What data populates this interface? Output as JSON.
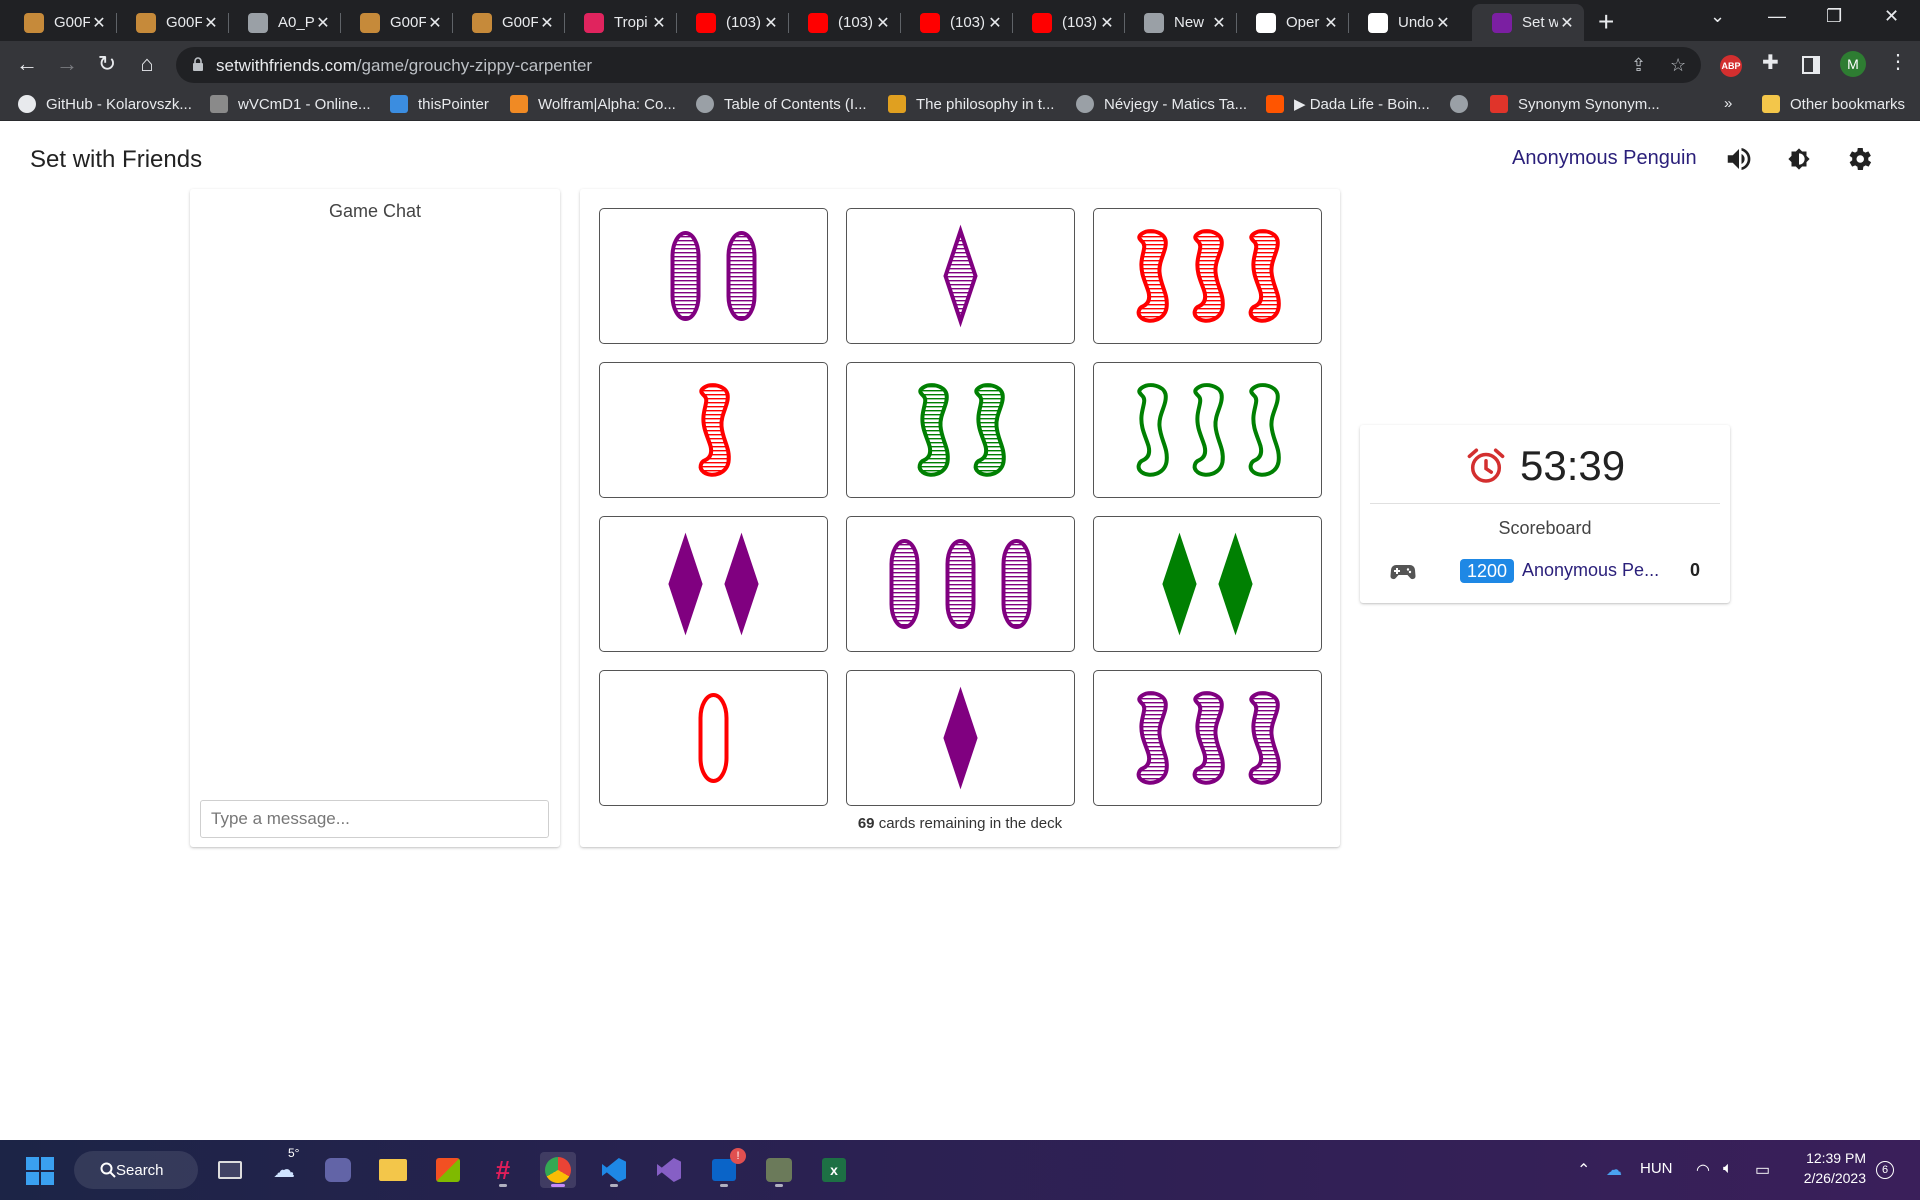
{
  "browser": {
    "tabs": [
      {
        "title": "G00F",
        "favicon": "box-icon",
        "color": "#c68a3a"
      },
      {
        "title": "G00F",
        "favicon": "box-icon",
        "color": "#c68a3a"
      },
      {
        "title": "A0_P",
        "favicon": "globe-icon",
        "color": "#9aa0a6"
      },
      {
        "title": "G00F",
        "favicon": "box-icon",
        "color": "#c68a3a"
      },
      {
        "title": "G00F",
        "favicon": "box-icon",
        "color": "#c68a3a"
      },
      {
        "title": "Tropi",
        "favicon": "flame-icon",
        "color": "#e0245e"
      },
      {
        "title": "(103)",
        "favicon": "youtube-icon",
        "color": "#ff0000"
      },
      {
        "title": "(103)",
        "favicon": "youtube-icon",
        "color": "#ff0000"
      },
      {
        "title": "(103)",
        "favicon": "youtube-icon",
        "color": "#ff0000"
      },
      {
        "title": "(103)",
        "favicon": "youtube-icon",
        "color": "#ff0000"
      },
      {
        "title": "New",
        "favicon": "chrome-icon",
        "color": "#9aa0a6"
      },
      {
        "title": "Oper",
        "favicon": "openai-icon",
        "color": "#ffffff"
      },
      {
        "title": "Undo",
        "favicon": "medium-icon",
        "color": "#ffffff"
      },
      {
        "title": "Set w",
        "favicon": "set-icon",
        "color": "#7b1fa2",
        "active": true
      }
    ],
    "url_host": "setwithfriends.com",
    "url_path": "/game/grouchy-zippy-carpenter",
    "profile_initial": "M",
    "bookmarks": [
      {
        "label": "GitHub - Kolarovszk...",
        "icon": "github-icon",
        "color": "#e8eaed"
      },
      {
        "label": "wVCmD1 - Online...",
        "icon": "ide-icon",
        "color": "#8a8a8a"
      },
      {
        "label": "thisPointer",
        "icon": "thispointer-icon",
        "color": "#3b8de0"
      },
      {
        "label": "Wolfram|Alpha: Co...",
        "icon": "wolfram-icon",
        "color": "#f08a24"
      },
      {
        "label": "Table of Contents (I...",
        "icon": "globe-icon",
        "color": "#9aa0a6"
      },
      {
        "label": "The philosophy in t...",
        "icon": "bars-icon",
        "color": "#e0a020"
      },
      {
        "label": "Névjegy - Matics Ta...",
        "icon": "globe-icon",
        "color": "#9aa0a6"
      },
      {
        "label": "▶ Dada Life - Boin...",
        "icon": "soundcloud-icon",
        "color": "#ff5500"
      },
      {
        "label": "",
        "icon": "globe-icon",
        "color": "#9aa0a6"
      },
      {
        "label": "Synonym Synonym...",
        "icon": "thesaurus-icon",
        "color": "#e0342a"
      }
    ],
    "bookmarks_overflow": "»",
    "other_bookmarks": "Other bookmarks"
  },
  "app": {
    "title": "Set with Friends",
    "user_name": "Anonymous Penguin"
  },
  "chat": {
    "title": "Game Chat",
    "placeholder": "Type a message..."
  },
  "board": {
    "cards": [
      {
        "count": 2,
        "shape": "oval",
        "color": "#800080",
        "shading": "striped"
      },
      {
        "count": 1,
        "shape": "diamond",
        "color": "#800080",
        "shading": "striped"
      },
      {
        "count": 3,
        "shape": "squiggle",
        "color": "#ff0000",
        "shading": "striped"
      },
      {
        "count": 1,
        "shape": "squiggle",
        "color": "#ff0000",
        "shading": "striped"
      },
      {
        "count": 2,
        "shape": "squiggle",
        "color": "#008002",
        "shading": "striped"
      },
      {
        "count": 3,
        "shape": "squiggle",
        "color": "#008002",
        "shading": "open"
      },
      {
        "count": 2,
        "shape": "diamond",
        "color": "#800080",
        "shading": "solid"
      },
      {
        "count": 3,
        "shape": "oval",
        "color": "#800080",
        "shading": "striped"
      },
      {
        "count": 2,
        "shape": "diamond",
        "color": "#008002",
        "shading": "solid"
      },
      {
        "count": 1,
        "shape": "oval",
        "color": "#ff0000",
        "shading": "open"
      },
      {
        "count": 1,
        "shape": "diamond",
        "color": "#800080",
        "shading": "solid"
      },
      {
        "count": 3,
        "shape": "squiggle",
        "color": "#800080",
        "shading": "striped"
      }
    ],
    "deck_count": "69",
    "deck_text": "cards remaining in the deck"
  },
  "scoreboard": {
    "timer": "53:39",
    "title": "Scoreboard",
    "players": [
      {
        "rating": "1200",
        "name": "Anonymous Pe...",
        "score": "0"
      }
    ]
  },
  "taskbar": {
    "search_label": "Search",
    "weather_temp": "5°",
    "language": "HUN",
    "time": "12:39 PM",
    "date": "2/26/2023",
    "notification_count": "6"
  }
}
